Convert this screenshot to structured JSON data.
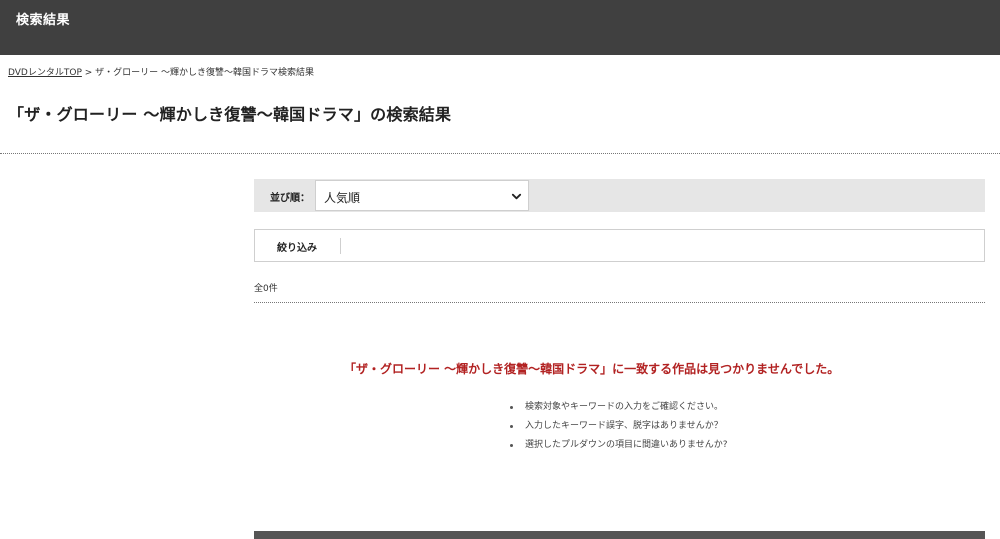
{
  "header": {
    "title": "検索結果"
  },
  "breadcrumb": {
    "home_link": "DVDレンタルTOP",
    "separator": ">",
    "current": "ザ・グローリー ～輝かしき復讐～韓国ドラマ検索結果"
  },
  "page_title": "「ザ・グローリー ～輝かしき復讐～韓国ドラマ」の検索結果",
  "sort": {
    "label": "並び順：",
    "selected": "人気順",
    "icon": "chevron-down-icon"
  },
  "filter": {
    "label": "絞り込み"
  },
  "results": {
    "count_text": "全0件",
    "not_found_message": "「ザ・グローリー ～輝かしき復讐～韓国ドラマ」に一致する作品は見つかりませんでした。",
    "hints": [
      "検索対象やキーワードの入力をご確認ください。",
      "入力したキーワード誤字、脱字はありませんか？",
      "選択したプルダウンの項目に間違いありませんか?"
    ]
  },
  "colors": {
    "header_bg": "#404040",
    "sortbar_bg": "#e6e6e6",
    "error_text": "#b22222",
    "footer_bg": "#555555"
  }
}
